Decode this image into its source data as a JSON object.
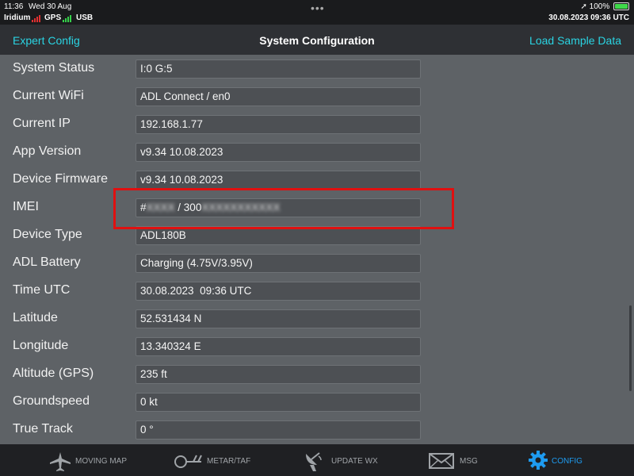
{
  "status_bar": {
    "time": "11:36",
    "date": "Wed 30 Aug",
    "iridium_label": "Iridium",
    "gps_label": "GPS",
    "usb_label": "USB",
    "battery_percent": "100%",
    "datetime_right": "30.08.2023  09:36 UTC"
  },
  "nav": {
    "left_link": "Expert Config",
    "title": "System Configuration",
    "right_link": "Load Sample Data"
  },
  "rows": [
    {
      "label": "System Status",
      "value": "I:0 G:5"
    },
    {
      "label": "Current WiFi",
      "value": "ADL Connect / en0"
    },
    {
      "label": "Current IP",
      "value": "192.168.1.77"
    },
    {
      "label": "App Version",
      "value": "v9.34 10.08.2023"
    },
    {
      "label": "Device Firmware",
      "value": "v9.34 10.08.2023"
    },
    {
      "label": "IMEI",
      "value_prefix": "#",
      "value_middle": " / 300",
      "value_blurred_1": "XXXX",
      "value_blurred_2": "XXXXXXXXXXX"
    },
    {
      "label": "Device Type",
      "value": "ADL180B"
    },
    {
      "label": "ADL Battery",
      "value": "Charging (4.75V/3.95V)"
    },
    {
      "label": "Time UTC",
      "value": "30.08.2023  09:36 UTC"
    },
    {
      "label": "Latitude",
      "value": "52.531434 N"
    },
    {
      "label": "Longitude",
      "value": "13.340324 E"
    },
    {
      "label": "Altitude (GPS)",
      "value": "235 ft"
    },
    {
      "label": "Groundspeed",
      "value": "0 kt"
    },
    {
      "label": "True Track",
      "value": "0 °"
    }
  ],
  "tabs": [
    {
      "label": "MOVING MAP",
      "icon": "airplane-icon",
      "active": false
    },
    {
      "label": "METAR/TAF",
      "icon": "weather-station-icon",
      "active": false
    },
    {
      "label": "UPDATE WX",
      "icon": "satellite-dish-icon",
      "active": false
    },
    {
      "label": "MSG",
      "icon": "envelope-icon",
      "active": false
    },
    {
      "label": "CONFIG",
      "icon": "gear-icon",
      "active": true
    }
  ],
  "colors": {
    "accent": "#2ad4e3",
    "active_tab": "#1e9bf0",
    "highlight_box": "#e01010"
  }
}
